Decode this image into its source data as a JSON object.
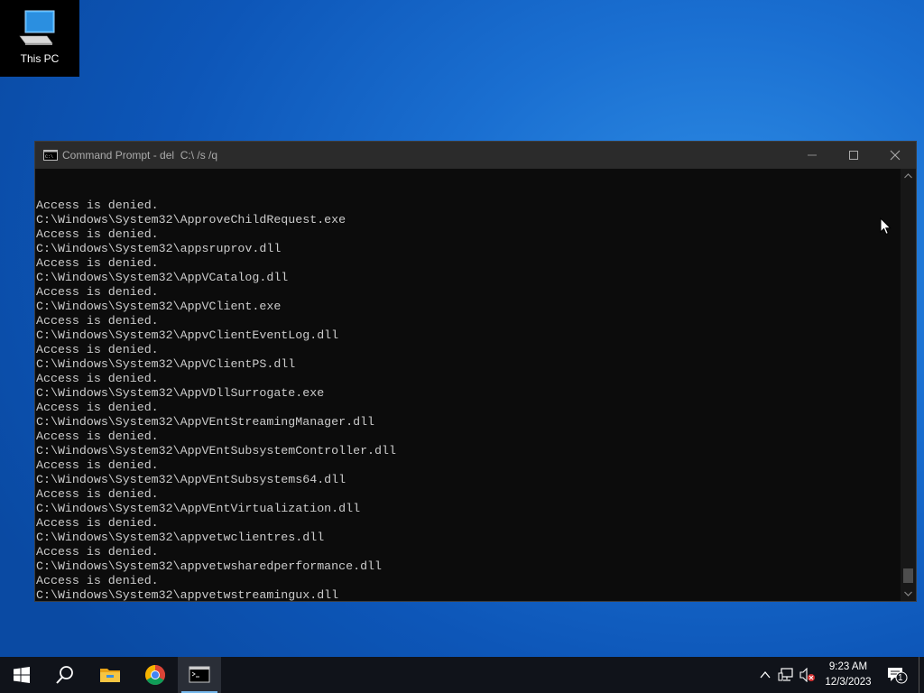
{
  "desktop": {
    "icons": [
      {
        "label": "This PC",
        "icon": "computer-icon"
      }
    ]
  },
  "cmd_window": {
    "title": "Command Prompt - del  C:\\ /s /q",
    "icon": "cmd-icon",
    "controls": {
      "minimize": "minimize-icon",
      "maximize": "maximize-icon",
      "close": "close-icon"
    },
    "lines": [
      "Access is denied.",
      "C:\\Windows\\System32\\ApproveChildRequest.exe",
      "Access is denied.",
      "C:\\Windows\\System32\\appsruprov.dll",
      "Access is denied.",
      "C:\\Windows\\System32\\AppVCatalog.dll",
      "Access is denied.",
      "C:\\Windows\\System32\\AppVClient.exe",
      "Access is denied.",
      "C:\\Windows\\System32\\AppvClientEventLog.dll",
      "Access is denied.",
      "C:\\Windows\\System32\\AppVClientPS.dll",
      "Access is denied.",
      "C:\\Windows\\System32\\AppVDllSurrogate.exe",
      "Access is denied.",
      "C:\\Windows\\System32\\AppVEntStreamingManager.dll",
      "Access is denied.",
      "C:\\Windows\\System32\\AppVEntSubsystemController.dll",
      "Access is denied.",
      "C:\\Windows\\System32\\AppVEntSubsystems64.dll",
      "Access is denied.",
      "C:\\Windows\\System32\\AppVEntVirtualization.dll",
      "Access is denied.",
      "C:\\Windows\\System32\\appvetwclientres.dll",
      "Access is denied.",
      "C:\\Windows\\System32\\appvetwsharedperformance.dll",
      "Access is denied.",
      "C:\\Windows\\System32\\appvetwstreamingux.dll",
      "Access is denied."
    ],
    "scroll_position": 0.99
  },
  "taskbar": {
    "items": [
      {
        "name": "start-button",
        "icon": "windows-logo-icon"
      },
      {
        "name": "search-button",
        "icon": "search-icon"
      },
      {
        "name": "file-explorer-button",
        "icon": "folder-icon"
      },
      {
        "name": "chrome-button",
        "icon": "chrome-icon"
      },
      {
        "name": "command-prompt-button",
        "icon": "cmd-icon",
        "active": true
      }
    ],
    "tray": {
      "icons": [
        "chevron-up-icon",
        "network-icon",
        "volume-muted-icon"
      ],
      "time": "9:23 AM",
      "date": "12/3/2023",
      "notification_count": "1"
    }
  },
  "colors": {
    "console_bg": "#0c0c0c",
    "console_text": "#cccccc",
    "taskbar_accent": "#76b9ed"
  }
}
